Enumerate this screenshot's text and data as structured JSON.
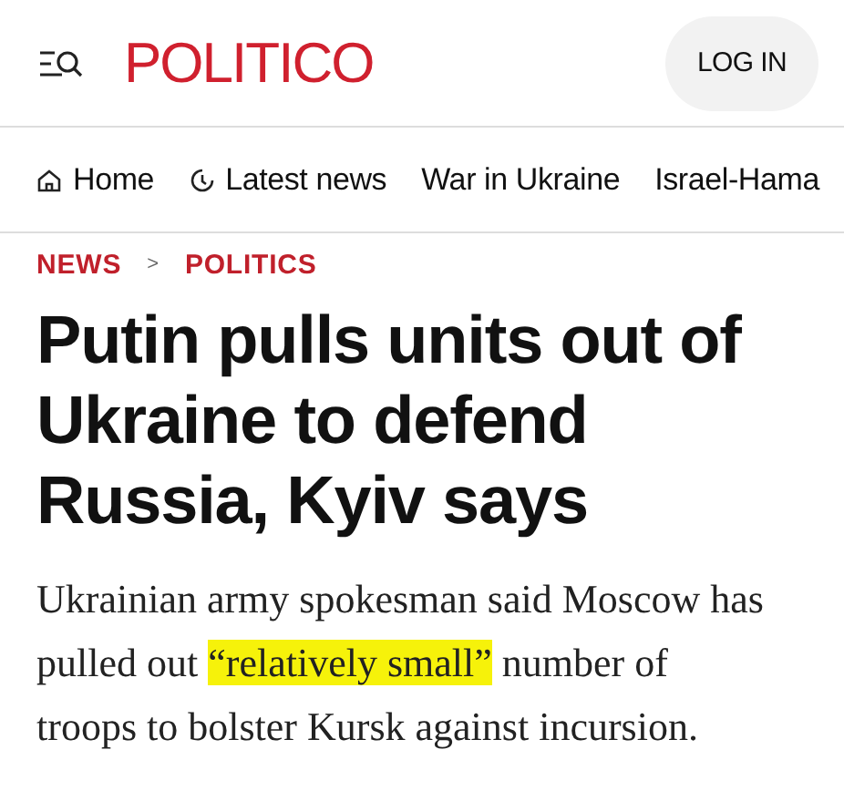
{
  "header": {
    "logo": "POLITICO",
    "login_button": "LOG IN"
  },
  "nav": [
    {
      "label": "Home",
      "kind": "home"
    },
    {
      "label": "Latest news",
      "kind": "latest"
    },
    {
      "label": "War in Ukraine",
      "kind": "topic"
    },
    {
      "label": "Israel-Hama",
      "kind": "topic"
    }
  ],
  "breadcrumb": {
    "items": [
      "NEWS",
      "POLITICS"
    ],
    "separator": ">"
  },
  "headline": "Putin pulls units out of Ukraine to defend Russia, Kyiv says",
  "summary": {
    "before": "Ukrainian army spokesman said Moscow has pulled out ",
    "highlighted": "“relatively small”",
    "after": " number of troops to bolster Kursk against incursion."
  }
}
